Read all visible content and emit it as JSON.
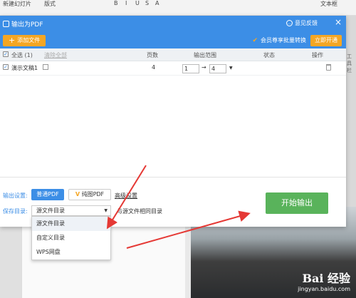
{
  "app": {
    "toolbar_items": [
      "新建幻灯片",
      "版式",
      "B",
      "I",
      "U",
      "S",
      "A",
      "文本框"
    ],
    "side_label": "工具栏"
  },
  "dialog": {
    "title": "输出为PDF",
    "feedback": "意见反馈",
    "close": "×",
    "add_file": "添加文件",
    "member_tip": "会员尊享批量转换",
    "open_member": "立即开通"
  },
  "table": {
    "select_all": "全选 (1)",
    "clear_all": "清除全部",
    "columns": {
      "pages": "页数",
      "range": "输出范围",
      "status": "状态",
      "action": "操作"
    },
    "rows": [
      {
        "name": "演示文稿1",
        "pages": "4",
        "from": "1",
        "arrow": "→",
        "to": "4"
      }
    ]
  },
  "settings": {
    "output_label": "输出设置:",
    "mode_normal": "普通PDF",
    "mode_pure_icon": "V",
    "mode_pure": "纯图PDF",
    "advanced": "高级设置",
    "save_label": "保存目录:",
    "save_selected": "源文件目录",
    "same_dir": "与源文件相同目录",
    "start": "开始输出"
  },
  "dropdown": {
    "options": [
      "源文件目录",
      "自定义目录",
      "WPS网盘"
    ]
  },
  "watermark": {
    "brand": "Bai 经验",
    "url": "jingyan.baidu.com"
  },
  "colors": {
    "primary": "#3c8ee6",
    "orange": "#f5a623",
    "green": "#59b35b",
    "arrow_red": "#e53935"
  }
}
